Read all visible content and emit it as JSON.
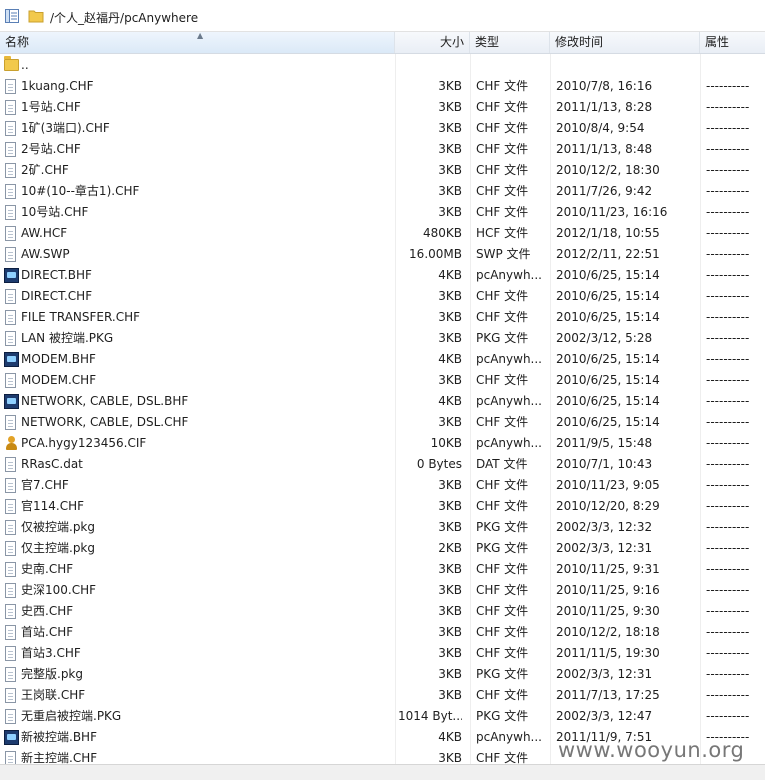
{
  "path": "/个人_赵福丹/pcAnywhere",
  "columns": {
    "name": "名称",
    "size": "大小",
    "type": "类型",
    "date": "修改时间",
    "attr": "属性"
  },
  "files": [
    {
      "icon": "folder",
      "name": "..",
      "size": "",
      "type": "",
      "date": "",
      "attr": ""
    },
    {
      "icon": "file",
      "name": "1kuang.CHF",
      "size": "3KB",
      "type": "CHF 文件",
      "date": "2010/7/8, 16:16",
      "attr": "----------"
    },
    {
      "icon": "file",
      "name": "1号站.CHF",
      "size": "3KB",
      "type": "CHF 文件",
      "date": "2011/1/13, 8:28",
      "attr": "----------"
    },
    {
      "icon": "file",
      "name": "1矿(3端口).CHF",
      "size": "3KB",
      "type": "CHF 文件",
      "date": "2010/8/4, 9:54",
      "attr": "----------"
    },
    {
      "icon": "file",
      "name": "2号站.CHF",
      "size": "3KB",
      "type": "CHF 文件",
      "date": "2011/1/13, 8:48",
      "attr": "----------"
    },
    {
      "icon": "file",
      "name": "2矿.CHF",
      "size": "3KB",
      "type": "CHF 文件",
      "date": "2010/12/2, 18:30",
      "attr": "----------"
    },
    {
      "icon": "file",
      "name": "10#(10--章古1).CHF",
      "size": "3KB",
      "type": "CHF 文件",
      "date": "2011/7/26, 9:42",
      "attr": "----------"
    },
    {
      "icon": "file",
      "name": "10号站.CHF",
      "size": "3KB",
      "type": "CHF 文件",
      "date": "2010/11/23, 16:16",
      "attr": "----------"
    },
    {
      "icon": "file",
      "name": "AW.HCF",
      "size": "480KB",
      "type": "HCF 文件",
      "date": "2012/1/18, 10:55",
      "attr": "----------"
    },
    {
      "icon": "file",
      "name": "AW.SWP",
      "size": "16.00MB",
      "type": "SWP 文件",
      "date": "2012/2/11, 22:51",
      "attr": "----------"
    },
    {
      "icon": "bhf",
      "name": "DIRECT.BHF",
      "size": "4KB",
      "type": "pcAnywh...",
      "date": "2010/6/25, 15:14",
      "attr": "----------"
    },
    {
      "icon": "file",
      "name": "DIRECT.CHF",
      "size": "3KB",
      "type": "CHF 文件",
      "date": "2010/6/25, 15:14",
      "attr": "----------"
    },
    {
      "icon": "file",
      "name": "FILE TRANSFER.CHF",
      "size": "3KB",
      "type": "CHF 文件",
      "date": "2010/6/25, 15:14",
      "attr": "----------"
    },
    {
      "icon": "file",
      "name": "LAN 被控端.PKG",
      "size": "3KB",
      "type": "PKG 文件",
      "date": "2002/3/12, 5:28",
      "attr": "----------"
    },
    {
      "icon": "bhf",
      "name": "MODEM.BHF",
      "size": "4KB",
      "type": "pcAnywh...",
      "date": "2010/6/25, 15:14",
      "attr": "----------"
    },
    {
      "icon": "file",
      "name": "MODEM.CHF",
      "size": "3KB",
      "type": "CHF 文件",
      "date": "2010/6/25, 15:14",
      "attr": "----------"
    },
    {
      "icon": "bhf",
      "name": "NETWORK, CABLE, DSL.BHF",
      "size": "4KB",
      "type": "pcAnywh...",
      "date": "2010/6/25, 15:14",
      "attr": "----------"
    },
    {
      "icon": "file",
      "name": "NETWORK, CABLE, DSL.CHF",
      "size": "3KB",
      "type": "CHF 文件",
      "date": "2010/6/25, 15:14",
      "attr": "----------"
    },
    {
      "icon": "cif",
      "name": "PCA.hygy123456.CIF",
      "size": "10KB",
      "type": "pcAnywh...",
      "date": "2011/9/5, 15:48",
      "attr": "----------"
    },
    {
      "icon": "file",
      "name": "RRasC.dat",
      "size": "0 Bytes",
      "type": "DAT 文件",
      "date": "2010/7/1, 10:43",
      "attr": "----------"
    },
    {
      "icon": "file",
      "name": "官7.CHF",
      "size": "3KB",
      "type": "CHF 文件",
      "date": "2010/11/23, 9:05",
      "attr": "----------"
    },
    {
      "icon": "file",
      "name": "官114.CHF",
      "size": "3KB",
      "type": "CHF 文件",
      "date": "2010/12/20, 8:29",
      "attr": "----------"
    },
    {
      "icon": "file",
      "name": "仅被控端.pkg",
      "size": "3KB",
      "type": "PKG 文件",
      "date": "2002/3/3, 12:32",
      "attr": "----------"
    },
    {
      "icon": "file",
      "name": "仅主控端.pkg",
      "size": "2KB",
      "type": "PKG 文件",
      "date": "2002/3/3, 12:31",
      "attr": "----------"
    },
    {
      "icon": "file",
      "name": "史南.CHF",
      "size": "3KB",
      "type": "CHF 文件",
      "date": "2010/11/25, 9:31",
      "attr": "----------"
    },
    {
      "icon": "file",
      "name": "史深100.CHF",
      "size": "3KB",
      "type": "CHF 文件",
      "date": "2010/11/25, 9:16",
      "attr": "----------"
    },
    {
      "icon": "file",
      "name": "史西.CHF",
      "size": "3KB",
      "type": "CHF 文件",
      "date": "2010/11/25, 9:30",
      "attr": "----------"
    },
    {
      "icon": "file",
      "name": "首站.CHF",
      "size": "3KB",
      "type": "CHF 文件",
      "date": "2010/12/2, 18:18",
      "attr": "----------"
    },
    {
      "icon": "file",
      "name": "首站3.CHF",
      "size": "3KB",
      "type": "CHF 文件",
      "date": "2011/11/5, 19:30",
      "attr": "----------"
    },
    {
      "icon": "file",
      "name": "完整版.pkg",
      "size": "3KB",
      "type": "PKG 文件",
      "date": "2002/3/3, 12:31",
      "attr": "----------"
    },
    {
      "icon": "file",
      "name": "王岗联.CHF",
      "size": "3KB",
      "type": "CHF 文件",
      "date": "2011/7/13, 17:25",
      "attr": "----------"
    },
    {
      "icon": "file",
      "name": "无重启被控端.PKG",
      "size": "1014 Byt...",
      "type": "PKG 文件",
      "date": "2002/3/3, 12:47",
      "attr": "----------"
    },
    {
      "icon": "bhf",
      "name": "新被控端.BHF",
      "size": "4KB",
      "type": "pcAnywh...",
      "date": "2011/11/9, 7:51",
      "attr": "----------"
    },
    {
      "icon": "file",
      "name": "新主控端.CHF",
      "size": "3KB",
      "type": "CHF 文件",
      "date": "",
      "attr": ""
    }
  ],
  "watermark": "www.wooyun.org"
}
